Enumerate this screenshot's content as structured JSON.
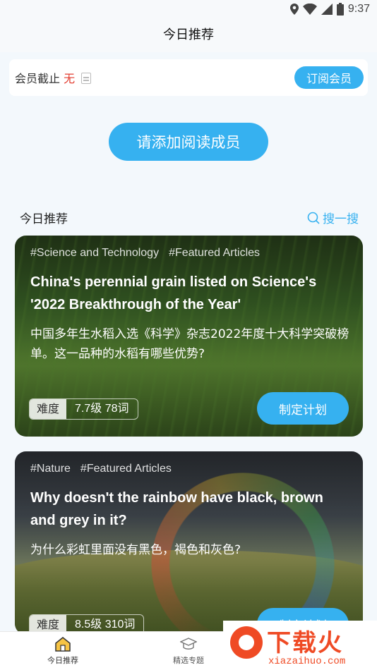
{
  "status_bar": {
    "time": "9:37"
  },
  "nav": {
    "title": "今日推荐"
  },
  "member": {
    "label": "会员截止",
    "value": "无",
    "subscribe_label": "订阅会员"
  },
  "add_member_label": "请添加阅读成员",
  "section": {
    "title": "今日推荐",
    "search_label": "搜一搜"
  },
  "articles": [
    {
      "tags": [
        "#Science and Technology",
        "#Featured Articles"
      ],
      "title": "China's perennial grain listed on Science's '2022 Breakthrough of the Year'",
      "subtitle": "中国多年生水稻入选《科学》杂志2022年度十大科学突破榜单。这一品种的水稻有哪些优势?",
      "difficulty_label": "难度",
      "difficulty_value": "7.7级  78词",
      "plan_label": "制定计划"
    },
    {
      "tags": [
        "#Nature",
        "#Featured Articles"
      ],
      "title": "Why doesn't the rainbow have black, brown and grey in it?",
      "subtitle": "为什么彩虹里面没有黑色，褐色和灰色?",
      "difficulty_label": "难度",
      "difficulty_value": "8.5级  310词",
      "plan_label": "制定计划"
    }
  ],
  "tabs": [
    {
      "label": "今日推荐",
      "icon": "home-icon"
    },
    {
      "label": "精选专题",
      "icon": "graduation-cap-icon"
    }
  ],
  "watermark": {
    "text": "下载火",
    "url": "xiazaihuo.com"
  },
  "colors": {
    "accent": "#36b1f0",
    "member_value": "#e23b2e",
    "watermark": "#ef4a24"
  }
}
